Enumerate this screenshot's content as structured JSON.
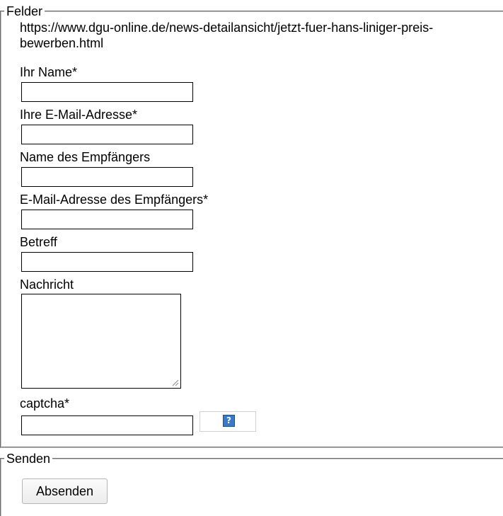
{
  "fields_legend": "Felder",
  "url_text": "https://www.dgu-online.de/news-detailansicht/jetzt-fuer-hans-liniger-preis-bewerben.html",
  "form": {
    "name_label": "Ihr Name*",
    "email_label": "Ihre E-Mail-Adresse*",
    "recipient_name_label": "Name des Empfängers",
    "recipient_email_label": "E-Mail-Adresse des Empfängers*",
    "subject_label": "Betreff",
    "message_label": "Nachricht",
    "captcha_label": "captcha*",
    "captcha_help_symbol": "?"
  },
  "send_legend": "Senden",
  "submit_label": "Absenden",
  "colors": {
    "help_icon": "#3a78c8"
  }
}
